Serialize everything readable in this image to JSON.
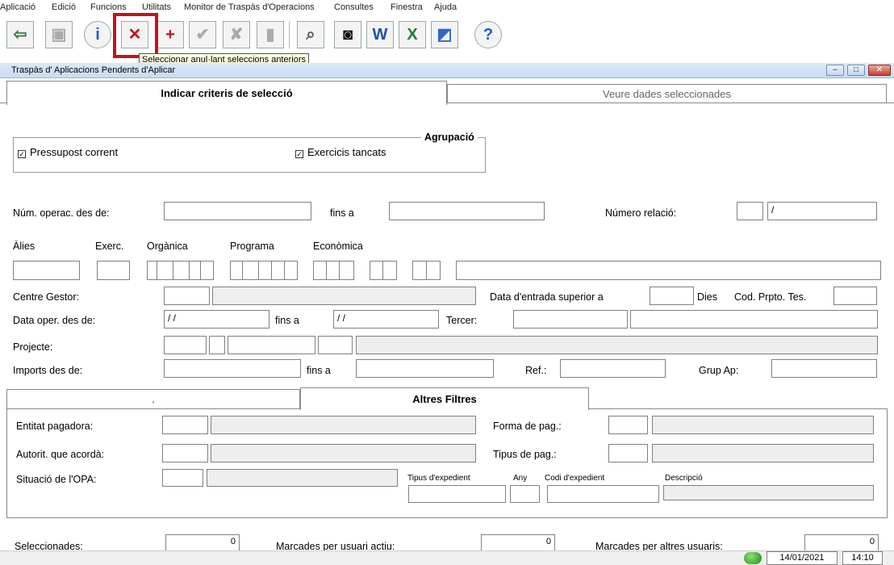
{
  "menu": [
    "Aplicació",
    "Edició",
    "Funcions",
    "Utilitats",
    "Monitor de Traspàs d'Operacions",
    "Consultes",
    "Finestra",
    "Ajuda"
  ],
  "tooltip": "Seleccionar anul·lant seleccions anteriors",
  "window_title": "Traspàs d' Aplicacions Pendents d'Aplicar",
  "tabs": {
    "criteria": "Indicar criteris de selecció",
    "view": "Veure dades seleccionades"
  },
  "grouping": {
    "title": "Agrupació",
    "current_budget": "Pressupost corrent",
    "closed_years": "Exercicis tancats"
  },
  "labels": {
    "num_from": "Núm. operac. des de:",
    "to": "fins a",
    "rel_number": "Número relació:",
    "alias": "Àlies",
    "exercise": "Exerc.",
    "organic": "Orgànica",
    "program": "Programa",
    "economic": "Econòmica",
    "center": "Centre Gestor:",
    "entry_date": "Data d'entrada superior a",
    "days": "Dies",
    "cod_prpto": "Cod. Prpto. Tes.",
    "date_from": "Data oper. des de:",
    "third": "Tercer:",
    "project": "Projecte:",
    "amounts_from": "Imports des de:",
    "ref": "Ref.:",
    "group_ap": "Grup Ap:"
  },
  "values": {
    "rel_sep": "/",
    "date_from": "/ /",
    "date_to": "/ /"
  },
  "inner_tabs": {
    "left": ".",
    "right": "Altres Filtres"
  },
  "filters": {
    "payer": "Entitat pagadora:",
    "authority": "Autorit. que acordà:",
    "status": "Situació de l'OPA:",
    "pay_form": "Forma de pag.:",
    "pay_type": "Tipus de pag.:",
    "file_type": "Tipus d'expedient",
    "year": "Any",
    "file_code": "Codi d'expedient",
    "description": "Descripció"
  },
  "footer": {
    "selected": "Seleccionades:",
    "selected_val": "0",
    "marked_active": "Marcades per usuari actiu:",
    "marked_active_val": "0",
    "marked_others": "Marcades per altres usuaris:",
    "marked_others_val": "0",
    "date": "14/01/2021",
    "time": "14:10"
  }
}
